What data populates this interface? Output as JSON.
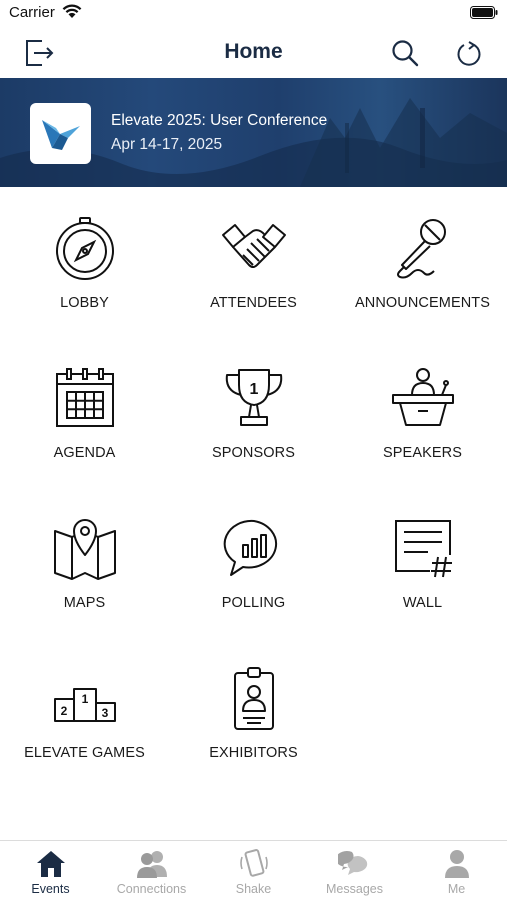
{
  "status_bar": {
    "carrier": "Carrier"
  },
  "nav": {
    "title": "Home"
  },
  "banner": {
    "event_name": "Elevate 2025: User Conference",
    "event_date": "Apr 14-17, 2025"
  },
  "tiles": [
    {
      "label": "LOBBY",
      "icon": "compass-icon"
    },
    {
      "label": "ATTENDEES",
      "icon": "handshake-icon"
    },
    {
      "label": "ANNOUNCEMENTS",
      "icon": "microphone-icon"
    },
    {
      "label": "AGENDA",
      "icon": "calendar-icon"
    },
    {
      "label": "SPONSORS",
      "icon": "trophy-icon"
    },
    {
      "label": "SPEAKERS",
      "icon": "podium-icon"
    },
    {
      "label": "MAPS",
      "icon": "map-icon"
    },
    {
      "label": "POLLING",
      "icon": "poll-chat-icon"
    },
    {
      "label": "WALL",
      "icon": "wall-post-icon"
    },
    {
      "label": "ELEVATE GAMES",
      "icon": "podium-ranking-icon"
    },
    {
      "label": "EXHIBITORS",
      "icon": "badge-icon"
    }
  ],
  "tab_bar": [
    {
      "label": "Events",
      "icon": "house-icon",
      "active": true
    },
    {
      "label": "Connections",
      "icon": "people-icon",
      "active": false
    },
    {
      "label": "Shake",
      "icon": "shake-phone-icon",
      "active": false
    },
    {
      "label": "Messages",
      "icon": "chat-bubbles-icon",
      "active": false
    },
    {
      "label": "Me",
      "icon": "person-icon",
      "active": false
    }
  ],
  "colors": {
    "nav_title": "#1b2c44",
    "banner": "#1f3f6d",
    "tab_active": "#1b2c44",
    "tab_inactive": "#a8a8a8"
  }
}
